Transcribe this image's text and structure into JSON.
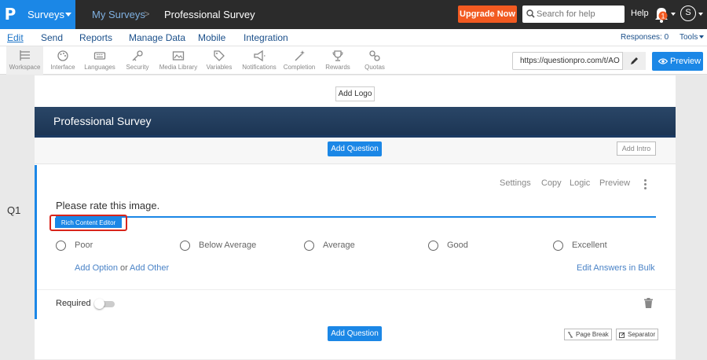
{
  "topbar": {
    "logo": "P",
    "surveys_label": "Surveys",
    "breadcrumb_parent": "My Surveys",
    "breadcrumb_separator": ">",
    "breadcrumb_current": "Professional Survey",
    "upgrade_label": "Upgrade Now",
    "search_placeholder": "Search for help",
    "help_label": "Help",
    "notification_count": "1",
    "avatar_initial": "S"
  },
  "nav": {
    "items": [
      "Edit",
      "Send",
      "Reports",
      "Manage Data",
      "Mobile",
      "Integration"
    ],
    "responses": "Responses: 0",
    "tools": "Tools"
  },
  "toolbar": {
    "items": [
      {
        "label": "Workspace",
        "icon": "workspace-icon"
      },
      {
        "label": "Interface",
        "icon": "palette-icon"
      },
      {
        "label": "Languages",
        "icon": "keyboard-icon"
      },
      {
        "label": "Security",
        "icon": "key-icon"
      },
      {
        "label": "Media Library",
        "icon": "image-icon"
      },
      {
        "label": "Variables",
        "icon": "tag-icon"
      },
      {
        "label": "Notifications",
        "icon": "megaphone-icon"
      },
      {
        "label": "Completion",
        "icon": "wand-icon"
      },
      {
        "label": "Rewards",
        "icon": "trophy-icon"
      },
      {
        "label": "Quotas",
        "icon": "quotas-icon"
      }
    ],
    "url": "https://questionpro.com/t/AO",
    "preview_label": "Preview"
  },
  "survey": {
    "add_logo": "Add Logo",
    "title": "Professional Survey",
    "add_question": "Add Question",
    "add_intro": "Add Intro"
  },
  "question": {
    "number": "Q1",
    "actions": [
      "Settings",
      "Copy",
      "Logic",
      "Preview"
    ],
    "text": "Please rate this image.",
    "rich_content_editor": "Rich Content Editor",
    "options": [
      "Poor",
      "Below Average",
      "Average",
      "Good",
      "Excellent"
    ],
    "add_option": "Add Option",
    "or": "or",
    "add_other": "Add Other",
    "edit_bulk": "Edit Answers in Bulk",
    "required": "Required"
  },
  "bottom": {
    "add_question": "Add Question",
    "page_break": "Page Break",
    "separator": "Separator"
  },
  "colors": {
    "accent": "#1b87e6",
    "upgrade": "#f25a21",
    "header": "#1c3554",
    "highlight": "#d9251b"
  }
}
